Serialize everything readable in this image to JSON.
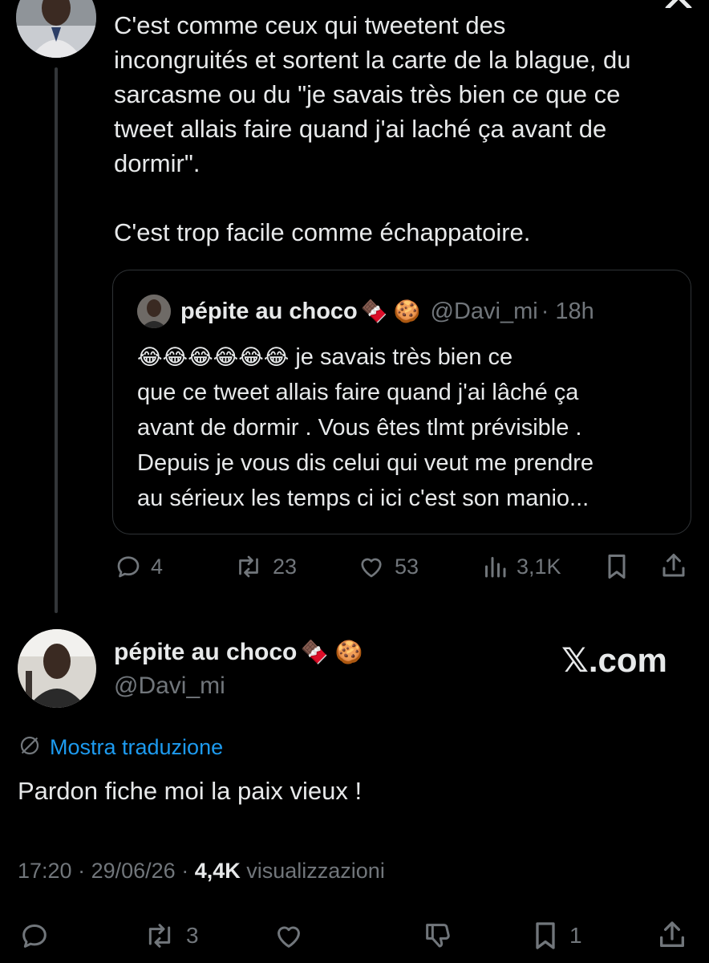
{
  "reply_tweet": {
    "text": "C'est comme ceux qui tweetent des\nincongruités et sortent la carte de la blague, du\nsarcasme ou du \"je savais très bien ce que ce\ntweet allais faire quand j'ai laché ça avant de\ndormir\".\n\nC'est trop facile comme échappatoire.",
    "actions": {
      "replies": "4",
      "retweets": "23",
      "likes": "53",
      "views": "3,1K"
    }
  },
  "quoted_tweet": {
    "name": "pépite au choco",
    "name_emojis": "🍫 🍪",
    "handle": "@Davi_mi",
    "time": "· 18h",
    "emojis": "😂😂😂😂😂😂",
    "text": " je savais très bien ce\nque ce tweet allais faire quand j'ai lâché ça\navant de dormir . Vous êtes tlmt prévisible .\nDepuis je vous dis celui qui veut me prendre\nau sérieux les temps ci ici c'est son manio..."
  },
  "main_tweet": {
    "name": "pépite au choco",
    "name_emojis": "🍫 🍪",
    "handle": "@Davi_mi",
    "watermark": "𝕏.com",
    "translate_label": "Mostra traduzione",
    "text": "Pardon fiche moi la paix vieux !",
    "time": "17:20",
    "date": "29/06/26",
    "views_count": "4,4K",
    "views_label": "visualizzazioni",
    "actions": {
      "retweets": "3",
      "bookmarks": "1"
    }
  },
  "colors": {
    "background": "#000000",
    "text": "#e7e9ea",
    "secondary": "#71767b",
    "link": "#1d9bf0",
    "border": "#2f3336"
  }
}
